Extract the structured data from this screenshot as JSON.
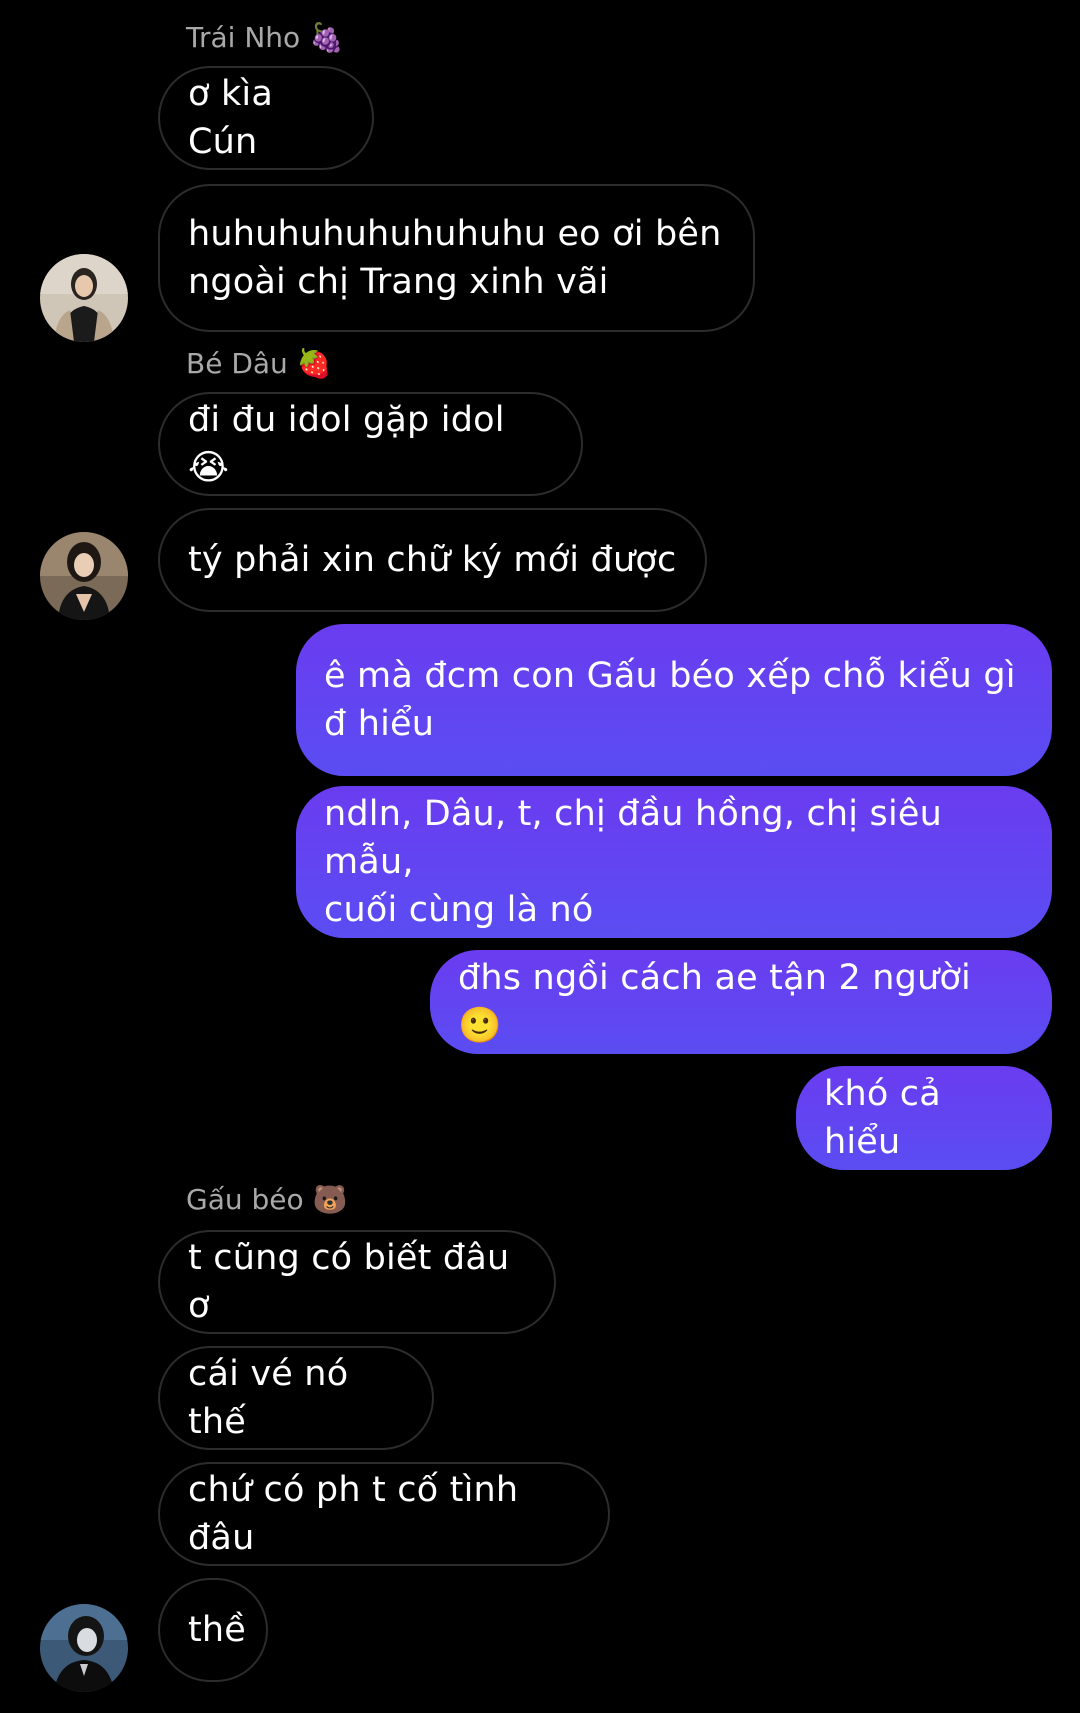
{
  "conversation": {
    "messages": [
      {
        "sender": "Trái Nho 🍇",
        "text": "ơ kìa Cún"
      },
      {
        "text": "huhuhuhuhuhuhuhu eo ơi bên\nngoài chị Trang xinh vãi"
      },
      {
        "sender": "Bé Dâu 🍓",
        "text": "đi đu idol gặp idol 😭"
      },
      {
        "text": "tý phải xin chữ ký mới được"
      },
      {
        "text": "ê mà đcm con Gấu béo xếp chỗ kiểu gì\nđ hiểu"
      },
      {
        "text": "ndln, Dâu, t, chị đầu hồng, chị siêu mẫu,\ncuối cùng là nó"
      },
      {
        "text": "đhs ngồi cách ae tận 2 người 🙂"
      },
      {
        "text": "khó cả hiểu"
      },
      {
        "sender": "Gấu béo 🐻",
        "text": "t cũng có biết đâu ơ"
      },
      {
        "text": "cái vé nó thế"
      },
      {
        "text": "chứ có ph t cố tình đâu"
      },
      {
        "text": "thề"
      }
    ]
  },
  "colors": {
    "background": "#000000",
    "incoming_border": "#2c2c2e",
    "outgoing_top": "#6a3cf0",
    "outgoing_bottom": "#5a4df2",
    "sender_name": "#a9a9a9"
  }
}
